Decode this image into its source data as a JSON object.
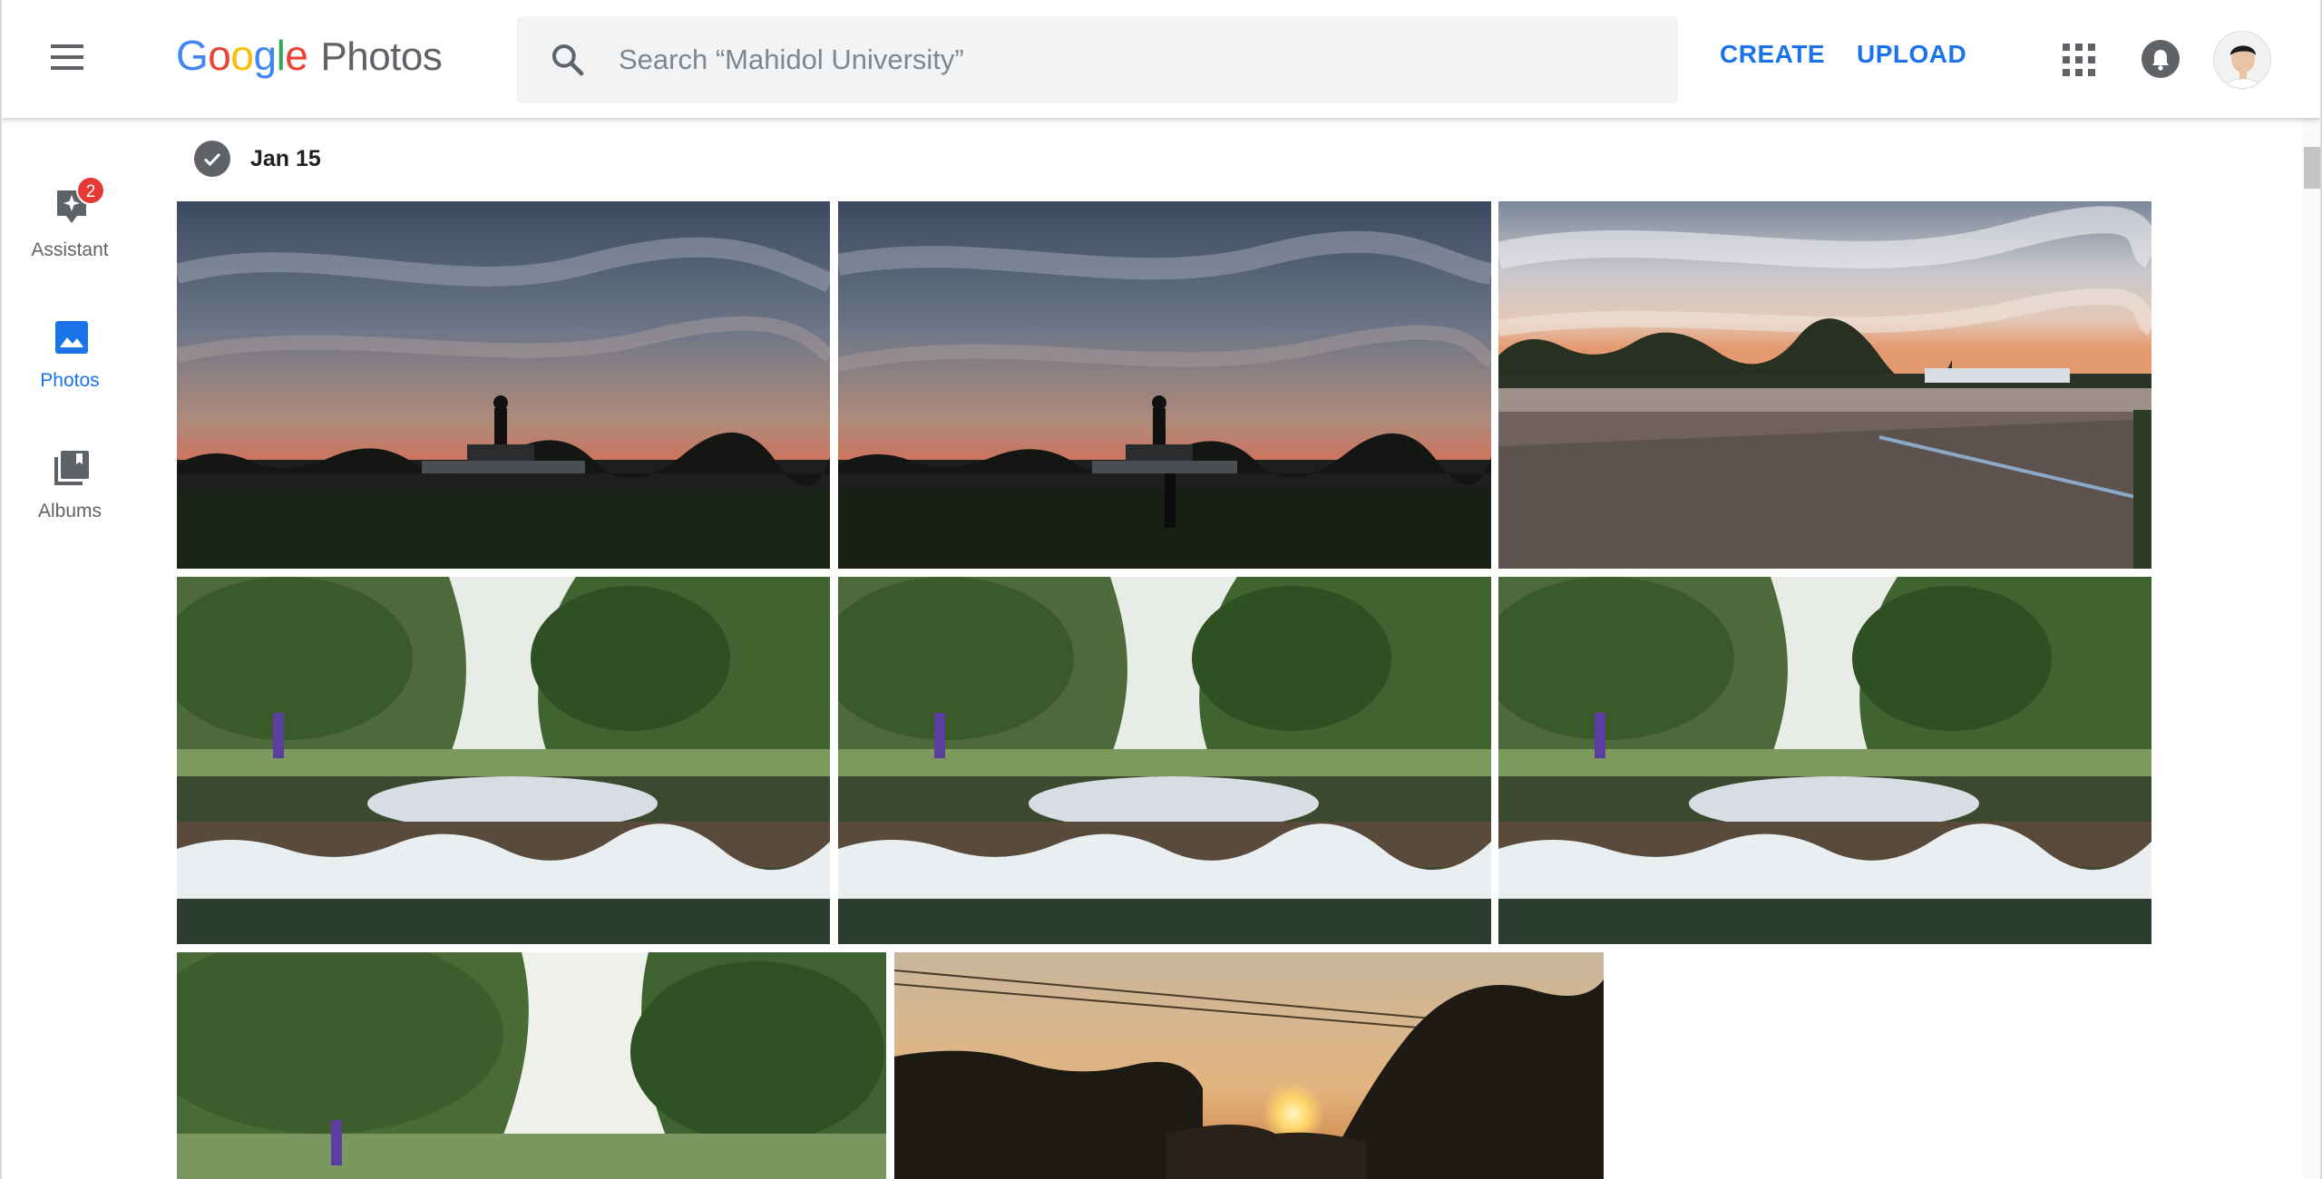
{
  "header": {
    "logo_letters": [
      "G",
      "o",
      "o",
      "g",
      "l",
      "e"
    ],
    "product_name": "Photos",
    "search": {
      "placeholder": "Search “Mahidol University”",
      "value": ""
    },
    "create_label": "CREATE",
    "upload_label": "UPLOAD",
    "icons": {
      "menu": "hamburger-menu-icon",
      "search": "magnifier-icon",
      "apps": "apps-grid-icon",
      "notifications": "bell-icon",
      "account": "user-avatar"
    }
  },
  "sidebar": {
    "items": [
      {
        "label": "Assistant",
        "icon": "assistant-sparkle-icon",
        "badge": "2",
        "active": false
      },
      {
        "label": "Photos",
        "icon": "image-icon",
        "active": true
      },
      {
        "label": "Albums",
        "icon": "albums-stack-icon",
        "active": false
      }
    ]
  },
  "content": {
    "date_group": "Jan 15",
    "photos": [
      {
        "subject": "sunset-buddha-statue-silhouette"
      },
      {
        "subject": "sunset-buddha-statue-silhouette"
      },
      {
        "subject": "sunset-lake-promenade"
      },
      {
        "subject": "waterfall-pond-trees-person"
      },
      {
        "subject": "waterfall-pond-trees-person"
      },
      {
        "subject": "waterfall-pond-trees-person"
      },
      {
        "subject": "trees-park-person"
      },
      {
        "subject": "sunset-behind-trees"
      }
    ]
  },
  "colors": {
    "accent": "#1a73e8",
    "icon_grey": "#5f6368",
    "badge_red": "#e53935",
    "search_bg": "#f1f3f4"
  }
}
